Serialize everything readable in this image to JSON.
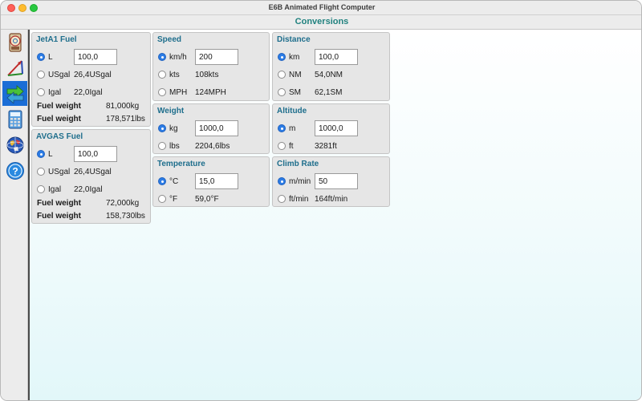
{
  "window": {
    "title": "E6B Animated Flight Computer"
  },
  "header": {
    "title": "Conversions"
  },
  "sidebar": {
    "items": [
      {
        "icon": "e6b-computer-icon",
        "active": false
      },
      {
        "icon": "triangle-vector-icon",
        "active": false
      },
      {
        "icon": "conversion-arrows-icon",
        "active": true
      },
      {
        "icon": "calculator-icon",
        "active": false
      },
      {
        "icon": "globe-icon",
        "active": false
      },
      {
        "icon": "help-icon",
        "active": false
      }
    ]
  },
  "jet_fuel": {
    "title": "JetA1 Fuel",
    "rows": [
      {
        "unit": "L",
        "selected": true,
        "value": "100,0"
      },
      {
        "unit": "USgal",
        "selected": false,
        "value": "26,4USgal"
      },
      {
        "unit": "Igal",
        "selected": false,
        "value": "22,0Igal"
      }
    ],
    "weights": [
      {
        "label": "Fuel weight",
        "value": "81,000kg"
      },
      {
        "label": "Fuel weight",
        "value": "178,571lbs"
      }
    ]
  },
  "avgas_fuel": {
    "title": "AVGAS Fuel",
    "rows": [
      {
        "unit": "L",
        "selected": true,
        "value": "100,0"
      },
      {
        "unit": "USgal",
        "selected": false,
        "value": "26,4USgal"
      },
      {
        "unit": "Igal",
        "selected": false,
        "value": "22,0Igal"
      }
    ],
    "weights": [
      {
        "label": "Fuel weight",
        "value": "72,000kg"
      },
      {
        "label": "Fuel weight",
        "value": "158,730lbs"
      }
    ]
  },
  "speed": {
    "title": "Speed",
    "rows": [
      {
        "unit": "km/h",
        "selected": true,
        "value": "200"
      },
      {
        "unit": "kts",
        "selected": false,
        "value": "108kts"
      },
      {
        "unit": "MPH",
        "selected": false,
        "value": "124MPH"
      }
    ]
  },
  "distance": {
    "title": "Distance",
    "rows": [
      {
        "unit": "km",
        "selected": true,
        "value": "100,0"
      },
      {
        "unit": "NM",
        "selected": false,
        "value": "54,0NM"
      },
      {
        "unit": "SM",
        "selected": false,
        "value": "62,1SM"
      }
    ]
  },
  "weight": {
    "title": "Weight",
    "rows": [
      {
        "unit": "kg",
        "selected": true,
        "value": "1000,0"
      },
      {
        "unit": "lbs",
        "selected": false,
        "value": "2204,6lbs"
      }
    ]
  },
  "altitude": {
    "title": "Altitude",
    "rows": [
      {
        "unit": "m",
        "selected": true,
        "value": "1000,0"
      },
      {
        "unit": "ft",
        "selected": false,
        "value": "3281ft"
      }
    ]
  },
  "temperature": {
    "title": "Temperature",
    "rows": [
      {
        "unit": "°C",
        "selected": true,
        "value": "15,0"
      },
      {
        "unit": "°F",
        "selected": false,
        "value": "59,0°F"
      }
    ]
  },
  "climb_rate": {
    "title": "Climb Rate",
    "rows": [
      {
        "unit": "m/min",
        "selected": true,
        "value": "50"
      },
      {
        "unit": "ft/min",
        "selected": false,
        "value": "164ft/min"
      }
    ]
  },
  "colors": {
    "accent": "#21827f",
    "panel_title": "#1e6e8c",
    "active_sidebar": "#1a6dd6",
    "radio_on": "#2c7ce5"
  }
}
